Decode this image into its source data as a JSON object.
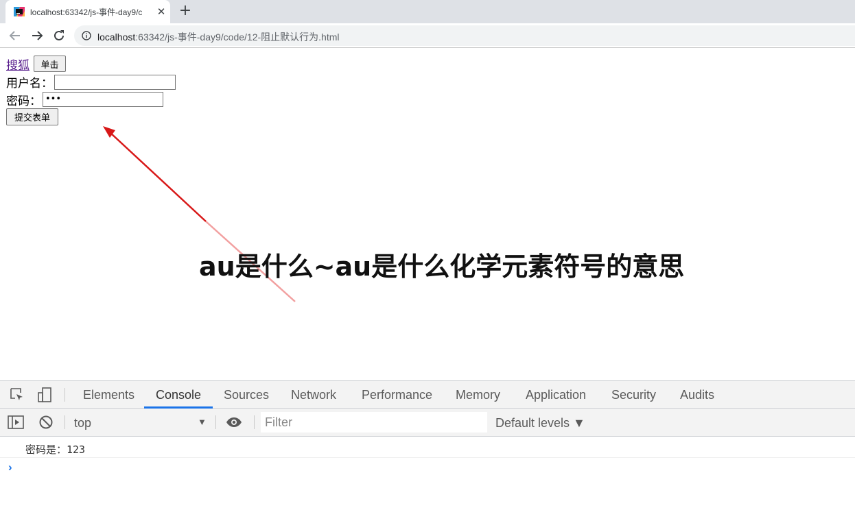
{
  "browser": {
    "tab": {
      "title": "localhost:63342/js-事件-day9/c",
      "close_glyph": "✕"
    },
    "new_tab_glyph": "+",
    "address": {
      "host": "localhost",
      "path": ":63342/js-事件-day9/code/12-阻止默认行为.html"
    }
  },
  "page": {
    "link_text": "搜狐",
    "click_button": "单击",
    "username_label": "用户名：",
    "username_value": "",
    "password_label": "密码：",
    "password_value": "•••",
    "submit_button": "提交表单"
  },
  "overlay": {
    "headline": "au是什么~au是什么化学元素符号的意思"
  },
  "devtools": {
    "tabs": [
      "Elements",
      "Console",
      "Sources",
      "Network",
      "Performance",
      "Memory",
      "Application",
      "Security",
      "Audits"
    ],
    "active_tab": "Console",
    "context": "top",
    "filter_placeholder": "Filter",
    "levels": "Default levels ▼",
    "log": "密码是：123",
    "prompt": "›"
  }
}
